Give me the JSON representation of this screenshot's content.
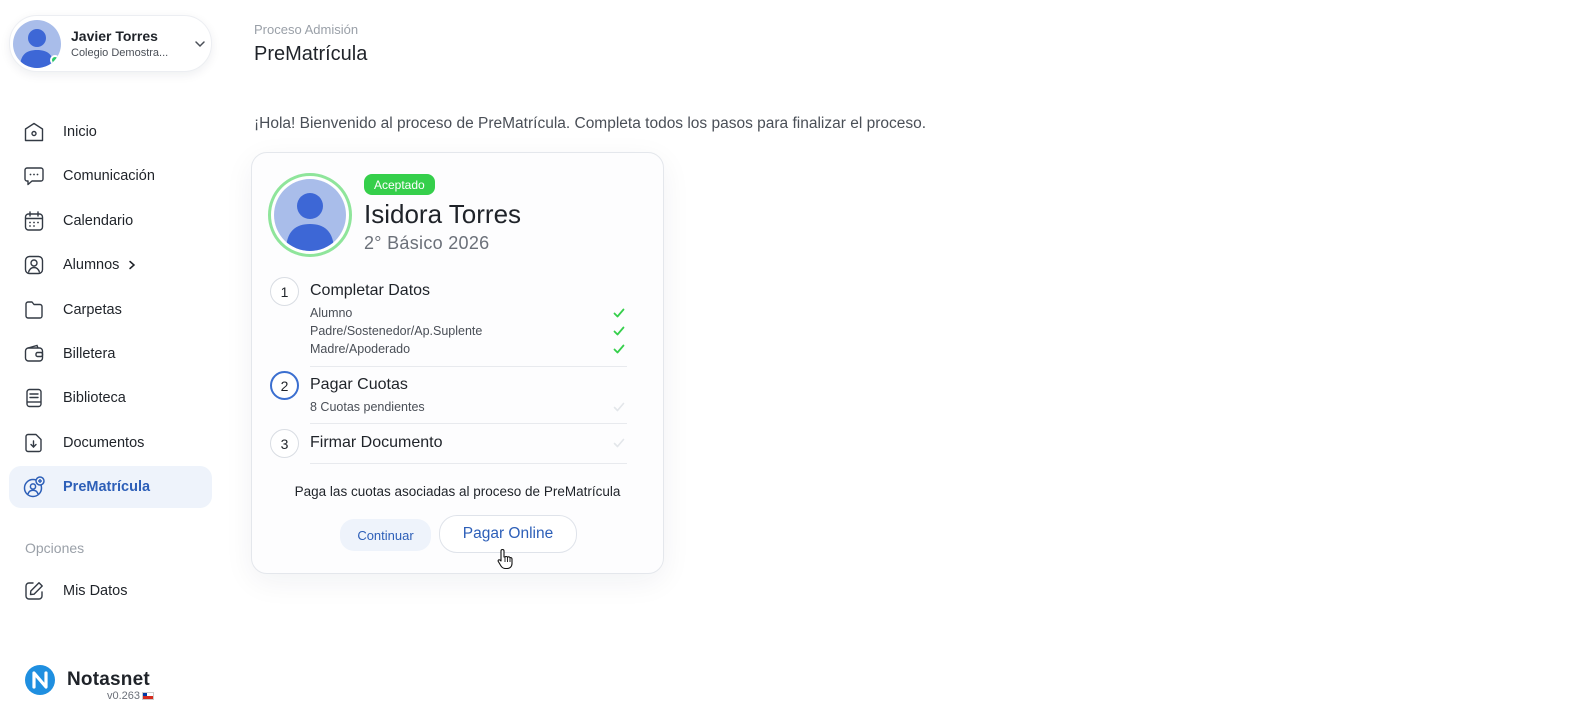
{
  "user": {
    "name": "Javier Torres",
    "school": "Colegio Demostra..."
  },
  "nav": {
    "items": [
      {
        "label": "Inicio",
        "icon": "home-icon"
      },
      {
        "label": "Comunicación",
        "icon": "chat-icon"
      },
      {
        "label": "Calendario",
        "icon": "calendar-icon"
      },
      {
        "label": "Alumnos",
        "icon": "student-icon"
      },
      {
        "label": "Carpetas",
        "icon": "folder-icon"
      },
      {
        "label": "Billetera",
        "icon": "wallet-icon"
      },
      {
        "label": "Biblioteca",
        "icon": "library-icon"
      },
      {
        "label": "Documentos",
        "icon": "document-icon"
      },
      {
        "label": "PreMatrícula",
        "icon": "enrollment-icon",
        "active": true
      }
    ],
    "options_title": "Opciones",
    "options": [
      {
        "label": "Mis Datos",
        "icon": "edit-icon"
      }
    ]
  },
  "brand": {
    "name": "Notasnet",
    "version": "v0.263"
  },
  "header": {
    "breadcrumb": "Proceso Admisión",
    "title": "PreMatrícula"
  },
  "welcome": "¡Hola! Bienvenido al proceso de PreMatrícula. Completa todos los pasos para finalizar el proceso.",
  "student": {
    "status": "Aceptado",
    "name": "Isidora Torres",
    "grade": "2° Básico 2026"
  },
  "steps": [
    {
      "number": "1",
      "title": "Completar Datos",
      "items": [
        {
          "label": "Alumno",
          "done": true
        },
        {
          "label": "Padre/Sostenedor/Ap.Suplente",
          "done": true
        },
        {
          "label": "Madre/Apoderado",
          "done": true
        }
      ]
    },
    {
      "number": "2",
      "title": "Pagar Cuotas",
      "current": true,
      "items": [
        {
          "label": "8 Cuotas pendientes",
          "done": false
        }
      ]
    },
    {
      "number": "3",
      "title": "Firmar Documento",
      "items": []
    }
  ],
  "help_text": "Paga las cuotas asociadas al proceso de PreMatrícula",
  "buttons": {
    "continue": "Continuar",
    "pay_online": "Pagar Online"
  },
  "colors": {
    "accent": "#2d5fb8",
    "success": "#35cf4b",
    "active_bg": "#eef3fb",
    "avatar": "#a9bdea"
  }
}
